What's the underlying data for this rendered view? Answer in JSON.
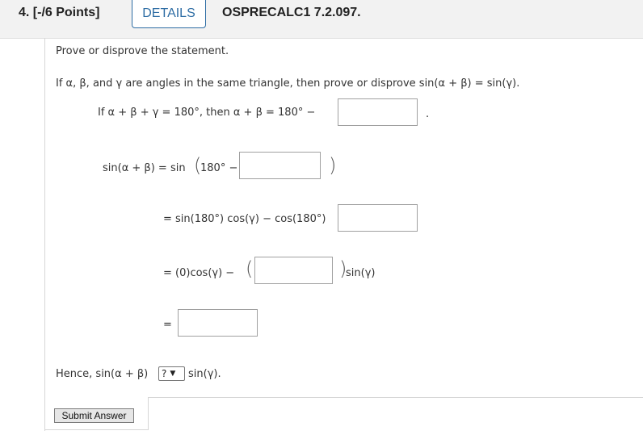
{
  "header": {
    "question_points": "4. [-/6 Points]",
    "details_label": "DETAILS",
    "question_code": "OSPRECALC1 7.2.097."
  },
  "problem": {
    "instruction": "Prove or disprove the statement.",
    "statement": "If α, β, and γ are angles in the same triangle, then prove or disprove sin(α + β) = sin(γ).",
    "line1": "If  α + β + γ = 180°,  then  α + β = 180° −",
    "line1_end": ".",
    "step1_lhs": "sin(α + β)  =  sin",
    "step1_inner": "180° −",
    "step2": "=  sin(180°) cos(γ) − cos(180°)",
    "step3_left": "=  (0)cos(γ) −",
    "step3_right": "sin(γ)",
    "step4": "="
  },
  "conclusion": {
    "prefix": "Hence,  sin(α + β)",
    "select_value": "?",
    "suffix": "sin(γ)."
  },
  "inputs": {
    "line1_answer": "",
    "step1_answer": "",
    "step2_answer": "",
    "step3_answer": "",
    "step4_answer": ""
  },
  "submit_label": "Submit Answer",
  "colors": {
    "accent": "#2e6da4",
    "header_bg": "#f2f2f2"
  }
}
